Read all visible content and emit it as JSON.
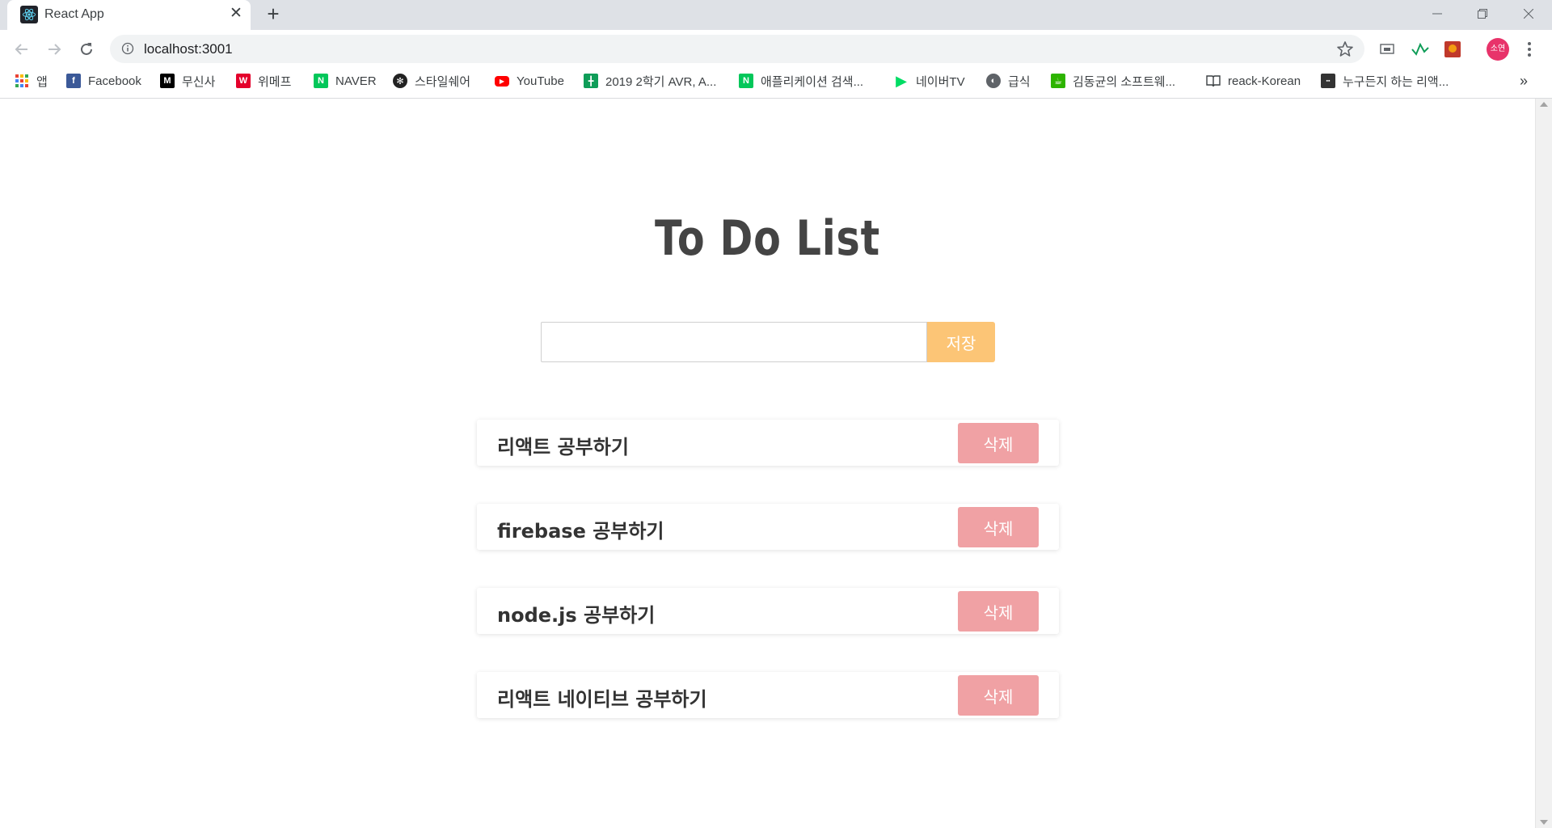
{
  "browser": {
    "tab_title": "React App",
    "tab_close": "✕",
    "new_tab": "+",
    "url": "localhost:3001",
    "profile_initials": "소연",
    "bookmarks_more": "»",
    "bookmarks": [
      {
        "label": "앱",
        "icon": "apps-grid-icon",
        "color": "#4285f4"
      },
      {
        "label": "Facebook",
        "icon": "facebook-icon",
        "color": "#3b5998"
      },
      {
        "label": "무신사",
        "icon": "musinsa-icon",
        "color": "#000000"
      },
      {
        "label": "위메프",
        "icon": "wemakeprice-icon",
        "color": "#e4002b"
      },
      {
        "label": "NAVER",
        "icon": "naver-icon",
        "color": "#03c75a"
      },
      {
        "label": "스타일쉐어",
        "icon": "styleshare-icon",
        "color": "#222222"
      },
      {
        "label": "YouTube",
        "icon": "youtube-icon",
        "color": "#ff0000"
      },
      {
        "label": "2019 2학기 AVR, A...",
        "icon": "sheets-icon",
        "color": "#0f9d58"
      },
      {
        "label": "애플리케이션 검색...",
        "icon": "naver-icon",
        "color": "#03c75a"
      },
      {
        "label": "네이버TV",
        "icon": "navertv-icon",
        "color": "#00dc64"
      },
      {
        "label": "급식",
        "icon": "globe-icon",
        "color": "#5f6368"
      },
      {
        "label": "김동균의 소프트웨...",
        "icon": "blog-icon",
        "color": "#2db400"
      },
      {
        "label": "reack-Korean",
        "icon": "book-icon",
        "color": "#3c4043"
      },
      {
        "label": "누구든지 하는 리액...",
        "icon": "site-icon",
        "color": "#333333"
      }
    ]
  },
  "app": {
    "title": "To Do List",
    "input_value": "",
    "save_label": "저장",
    "accent_save": "#fcc576",
    "accent_delete": "#f0a1a4",
    "todos": [
      {
        "text": "리액트 공부하기",
        "delete_label": "삭제"
      },
      {
        "text": "firebase 공부하기",
        "delete_label": "삭제"
      },
      {
        "text": "node.js 공부하기",
        "delete_label": "삭제"
      },
      {
        "text": "리액트 네이티브 공부하기",
        "delete_label": "삭제"
      }
    ]
  }
}
